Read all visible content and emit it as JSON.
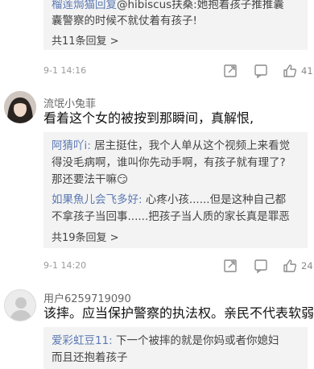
{
  "thread1": {
    "reply_lines": [
      {
        "author": "榴莲焗猫回复",
        "text": "@hibiscus扶桑:她抱着孩子推推囊"
      },
      {
        "author": "",
        "text": "囊警察的时候不就仗着有孩子!"
      }
    ],
    "more_replies": "共11条回复 >",
    "time": "9-1 14:16",
    "likes": "41"
  },
  "comment2": {
    "username": "流氓小兔菲",
    "text": "看着这个女的被按到那瞬间，真解恨,",
    "replies": [
      {
        "author": "阿猜吖i:",
        "lines": [
          " 居主挺住，我个人单从这个视频上来看觉",
          "得没毛病啊，谁叫你先动手啊，有孩子就有理了?",
          "那还要法干嘛"
        ],
        "emoji": "😏"
      },
      {
        "author": "如果魚儿会飞多好:",
        "lines": [
          " 心疼小孩......但是这种自己都",
          "不拿孩子当回事......把孩子当人质的家长真是罪恶"
        ]
      }
    ],
    "more_replies": "共19条回复 >",
    "time": "9-1 14:20",
    "likes": "24"
  },
  "comment3": {
    "username": "用户6259719090",
    "text": "该摔。应当保护警察的执法权。亲民不代表软弱。",
    "replies": [
      {
        "author": "爱彩虹豆11:",
        "lines": [
          " 下一个被摔的就是你妈或者你媳妇",
          "而且还抱着孩子"
        ]
      }
    ]
  },
  "icons": {
    "share": "share-icon",
    "comment": "comment-icon",
    "like": "thumbs-up-icon"
  },
  "colors": {
    "reply_author": "#5b79b2",
    "reply_bg": "#f3f3f3",
    "meta_gray": "#9a9a9a"
  }
}
